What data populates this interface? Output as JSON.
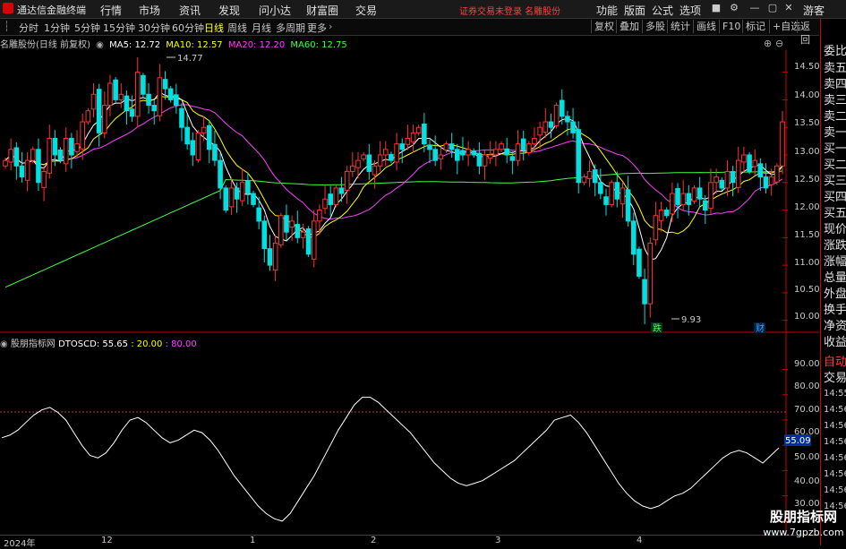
{
  "app": {
    "title": "通达信金融终端"
  },
  "menu": [
    "行情",
    "市场",
    "资讯",
    "发现",
    "问小达",
    "财富圈",
    "交易"
  ],
  "warning": "证券交易未登录  名雕股份",
  "right_menu": [
    "功能",
    "版面",
    "公式",
    "选项"
  ],
  "guest": "游客",
  "periods": [
    "分时",
    "1分钟",
    "5分钟",
    "15分钟",
    "30分钟",
    "60分钟",
    "日线",
    "周线",
    "月线",
    "多周期",
    "更多"
  ],
  "active_period": "日线",
  "right_tools": [
    "复权",
    "叠加",
    "多股",
    "统计",
    "画线",
    "F10",
    "标记",
    "+自选",
    "返回"
  ],
  "info": {
    "name": "名雕股份(日线 前复权)",
    "ma5": "MA5: 12.72",
    "ma10": "MA10: 12.57",
    "ma20": "MA20: 12.20",
    "ma60": "MA60: 12.75",
    "colors": {
      "ma5": "#ffffff",
      "ma10": "#ffff00",
      "ma20": "#ff40ff",
      "ma60": "#40ff40"
    }
  },
  "ind_info": {
    "name": "股朋指标网",
    "label": "DTOSCD: 55.65",
    "v2": ": 20.00",
    "v3": ": 80.00"
  },
  "side_panel": [
    "委比",
    "卖五",
    "卖四",
    "卖三",
    "卖二",
    "卖一",
    "买一",
    "买二",
    "买三",
    "买四",
    "买五",
    "现价",
    "涨跌",
    "涨幅",
    "总量",
    "外盘",
    "换手",
    "净资",
    "收益"
  ],
  "side_buttons": [
    "自动",
    "交易"
  ],
  "side_times": [
    "14:55",
    "14:56",
    "14:56",
    "14:56",
    "14:56",
    "14:56",
    "14:56",
    "14:56"
  ],
  "price_ticks": [
    "14.50",
    "14.00",
    "13.50",
    "13.00",
    "12.50",
    "12.00",
    "11.50",
    "11.00",
    "10.50",
    "10.00"
  ],
  "ind_ticks": [
    "90.00",
    "80.00",
    "70.00",
    "60.00",
    "50.00",
    "40.00",
    "30.00"
  ],
  "ind_current": "55.09",
  "hi_label": "14.77",
  "lo_label": "9.93",
  "markers": {
    "die": "跌",
    "cai": "财"
  },
  "dates": [
    "2024年",
    "12",
    "1",
    "2",
    "3",
    "4"
  ],
  "watermark": {
    "name": "股朋指标网",
    "url": "www.7gpzb.com"
  },
  "chart_data": [
    {
      "type": "candlestick",
      "title": "名雕股份(日线 前复权)",
      "ylim": [
        9.8,
        14.9
      ],
      "hi": 14.77,
      "lo": 9.93,
      "closes": [
        12.9,
        13.1,
        12.8,
        12.6,
        12.9,
        13.1,
        12.5,
        12.7,
        13.3,
        13.0,
        12.9,
        13.3,
        13.0,
        13.2,
        13.6,
        13.8,
        14.1,
        13.4,
        13.9,
        14.3,
        14.0,
        14.1,
        13.8,
        13.7,
        14.5,
        14.1,
        13.9,
        13.8,
        14.4,
        14.2,
        14.0,
        13.9,
        13.5,
        13.2,
        13.0,
        13.4,
        13.5,
        13.1,
        12.9,
        12.4,
        12.0,
        12.4,
        12.2,
        12.5,
        12.3,
        12.1,
        11.8,
        11.3,
        11.0,
        11.4,
        11.9,
        11.6,
        11.8,
        11.5,
        11.6,
        11.2,
        11.8,
        12.0,
        12.2,
        12.1,
        12.4,
        12.3,
        12.7,
        12.8,
        12.9,
        13.0,
        12.7,
        12.8,
        13.0,
        13.1,
        12.9,
        13.2,
        13.1,
        13.3,
        13.4,
        13.5,
        13.2,
        13.1,
        12.9,
        13.0,
        13.2,
        13.1,
        12.9,
        13.0,
        13.1,
        13.0,
        12.8,
        13.0,
        13.0,
        13.1,
        13.2,
        13.0,
        12.9,
        13.2,
        13.1,
        13.2,
        13.3,
        13.5,
        13.6,
        13.5,
        13.9,
        13.7,
        13.6,
        13.4,
        12.5,
        12.6,
        12.7,
        12.5,
        12.3,
        12.1,
        12.5,
        12.2,
        12.4,
        11.8,
        11.2,
        10.8,
        10.3,
        11.4,
        11.9,
        12.0,
        11.9,
        12.3,
        12.1,
        12.3,
        12.1,
        12.4,
        12.2,
        12.0,
        12.5,
        12.6,
        12.4,
        12.7,
        12.5,
        12.9,
        13.0,
        12.7,
        12.9,
        12.6,
        12.4,
        12.6,
        12.8,
        13.6
      ],
      "ma": [
        {
          "name": "MA5",
          "last": 12.72
        },
        {
          "name": "MA10",
          "last": 12.57
        },
        {
          "name": "MA20",
          "last": 12.2
        },
        {
          "name": "MA60",
          "last": 12.75
        }
      ]
    },
    {
      "type": "line",
      "series": [
        {
          "name": "DTOSCD",
          "last": 55.65
        }
      ],
      "ylim": [
        25,
        98
      ],
      "ref_lines": [
        20,
        80
      ],
      "dtoscd": [
        63,
        64,
        66,
        69,
        72,
        74,
        75,
        73,
        70,
        65,
        60,
        56,
        55,
        57,
        61,
        66,
        70,
        71,
        69,
        66,
        63,
        61,
        62,
        64,
        66,
        65,
        62,
        58,
        53,
        48,
        44,
        40,
        36,
        33,
        31,
        30,
        33,
        38,
        43,
        48,
        54,
        60,
        66,
        71,
        76,
        79,
        79,
        77,
        74,
        71,
        68,
        65,
        61,
        57,
        53,
        50,
        47,
        45,
        44,
        45,
        46,
        48,
        50,
        52,
        54,
        57,
        60,
        63,
        66,
        70,
        71,
        72,
        69,
        65,
        60,
        55,
        50,
        45,
        41,
        38,
        36,
        35,
        36,
        38,
        40,
        41,
        43,
        46,
        49,
        52,
        55,
        57,
        58,
        57,
        55,
        53,
        56,
        59
      ],
      "current": 55.09
    }
  ]
}
